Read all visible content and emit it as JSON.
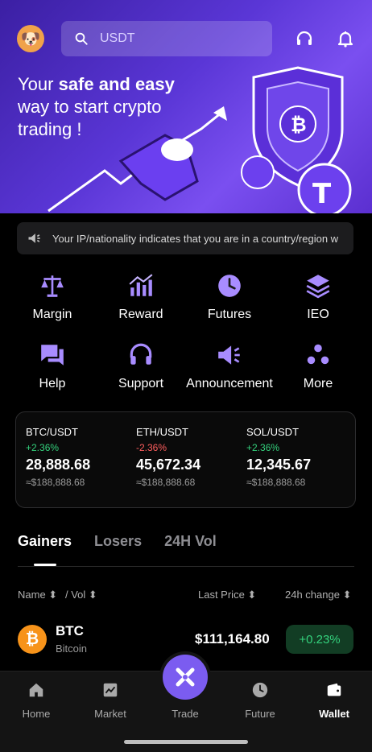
{
  "header": {
    "search_placeholder": "USDT",
    "avatar_icon": "dog-avatar-icon",
    "icons": [
      "headset-icon",
      "bell-icon"
    ]
  },
  "hero": {
    "line1_pre": "Your ",
    "line1_bold": "safe and easy",
    "line2": "way to start crypto",
    "line3": "trading !"
  },
  "notice": {
    "text": "Your IP/nationality indicates that you are in a country/region w"
  },
  "quick_actions": [
    {
      "label": "Margin",
      "icon": "scale-icon"
    },
    {
      "label": "Reward",
      "icon": "chart-up-icon"
    },
    {
      "label": "Futures",
      "icon": "clock-icon"
    },
    {
      "label": "IEO",
      "icon": "layers-icon"
    },
    {
      "label": "Help",
      "icon": "chat-icon"
    },
    {
      "label": "Support",
      "icon": "headset-icon"
    },
    {
      "label": "Announcement",
      "icon": "megaphone-icon"
    },
    {
      "label": "More",
      "icon": "dots-icon"
    }
  ],
  "tickers": [
    {
      "pair": "BTC/USDT",
      "change": "+2.36%",
      "price": "28,888.68",
      "fiat": "≈$188,888.68",
      "dir": "up"
    },
    {
      "pair": "ETH/USDT",
      "change": "-2.36%",
      "price": "45,672.34",
      "fiat": "≈$188,888.68",
      "dir": "down"
    },
    {
      "pair": "SOL/USDT",
      "change": "+2.36%",
      "price": "12,345.67",
      "fiat": "≈$188,888.68",
      "dir": "up"
    }
  ],
  "market_tabs": [
    "Gainers",
    "Losers",
    "24H Vol"
  ],
  "columns": {
    "name": "Name ⬍",
    "vol": "/ Vol ⬍",
    "last_price": "Last Price ⬍",
    "change": "24h change ⬍"
  },
  "rows": [
    {
      "symbol": "BTC",
      "name": "Bitcoin",
      "coin_glyph": "₿",
      "last_price": "$111,164.80",
      "change": "+0.23%"
    }
  ],
  "nav": [
    {
      "label": "Home",
      "icon": "home-icon"
    },
    {
      "label": "Market",
      "icon": "market-chart-icon"
    },
    {
      "label": "Trade",
      "icon": "trade-icon"
    },
    {
      "label": "Future",
      "icon": "clock-icon"
    },
    {
      "label": "Wallet",
      "icon": "wallet-icon"
    }
  ],
  "colors": {
    "accent": "#7b5cf0",
    "up": "#34d27d",
    "down": "#ff5e5e"
  }
}
